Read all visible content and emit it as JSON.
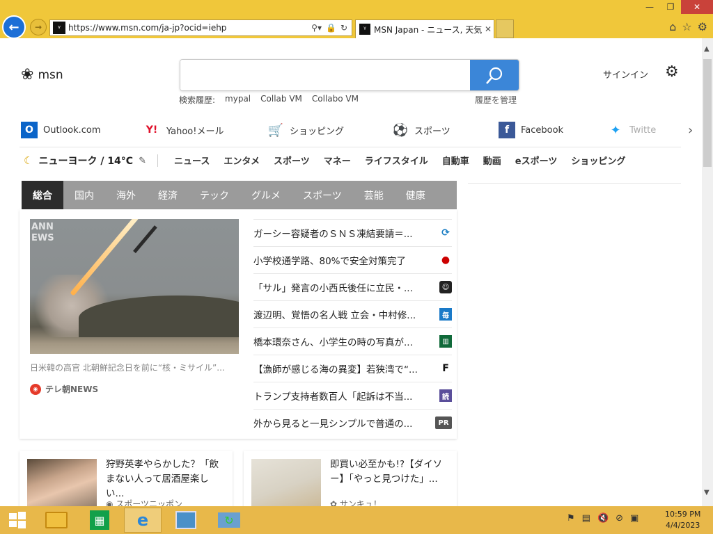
{
  "browser": {
    "url": "https://www.msn.com/ja-jp?ocid=iehp",
    "tab_title": "MSN Japan - ニュース, 天気,...",
    "favicon_letter": "ᵞ"
  },
  "header": {
    "logo_text": "msn",
    "search_placeholder": "",
    "history_label": "検索履歴:",
    "history_items": [
      "mypal",
      "Collab VM",
      "Collabo VM"
    ],
    "history_manage": "履歴を管理",
    "signin": "サインイン"
  },
  "quicklinks": [
    {
      "label": "Outlook.com",
      "icon": "outlook-icon",
      "color": "#0a64c8"
    },
    {
      "label": "Yahoo!メール",
      "icon": "yahoo-icon",
      "color": "#e0102a"
    },
    {
      "label": "ショッピング",
      "icon": "cart-icon",
      "color": "#1a5fd0"
    },
    {
      "label": "スポーツ",
      "icon": "sports-icon",
      "color": "#1a3a80"
    },
    {
      "label": "Facebook",
      "icon": "facebook-icon",
      "color": "#3b5998"
    },
    {
      "label": "Twitte",
      "icon": "twitter-icon",
      "color": "#1da1f2"
    }
  ],
  "weather": {
    "location_temp": "ニューヨーク / 14°C"
  },
  "categories": [
    "ニュース",
    "エンタメ",
    "スポーツ",
    "マネー",
    "ライフスタイル",
    "自動車",
    "動画",
    "eスポーツ",
    "ショッピング"
  ],
  "news_tabs": [
    "総合",
    "国内",
    "海外",
    "経済",
    "テック",
    "グルメ",
    "スポーツ",
    "芸能",
    "健康"
  ],
  "hero": {
    "image_watermark_1": "ANN",
    "image_watermark_2": "EWS",
    "caption": "日米韓の高官 北朝鮮記念日を前に“核・ミサイル”...",
    "source": "テレ朝NEWS"
  },
  "headlines": [
    {
      "text": "ガーシー容疑者のＳＮＳ凍結要請＝...",
      "src_color": "#1c7fc4",
      "src_char": "⟳"
    },
    {
      "text": "小学校通学路、80%で安全対策完了",
      "src_color": "#ffffff",
      "src_char": "●"
    },
    {
      "text": "「サル」発言の小西氏後任に立民・...",
      "src_color": "#222222",
      "src_char": "☺"
    },
    {
      "text": "渡辺明、覚悟の名人戦 立会・中村修...",
      "src_color": "#1a7ac8",
      "src_char": "毎"
    },
    {
      "text": "橋本環奈さん、小学生の時の写真が...",
      "src_color": "#106a3a",
      "src_char": "▥"
    },
    {
      "text": "【漁師が感じる海の異変】若狭湾で“...",
      "src_color": "#ffffff",
      "src_char": "F"
    },
    {
      "text": "トランプ支持者数百人「起訴は不当...",
      "src_color": "#5a4f9a",
      "src_char": "読"
    },
    {
      "text": "外から見ると一見シンプルで普通の...",
      "src_color": "#555555",
      "src_char": "PR"
    }
  ],
  "cards": [
    {
      "title": "狩野英孝やらかした？「飲まない人って居酒屋楽しい...",
      "source": "スポーツニッポン"
    },
    {
      "title": "即買い必至かも!?【ダイソー】「やっと見つけた」...",
      "source": "サンキュ！"
    }
  ],
  "clock": {
    "time": "10:59 PM",
    "date": "4/4/2023"
  }
}
